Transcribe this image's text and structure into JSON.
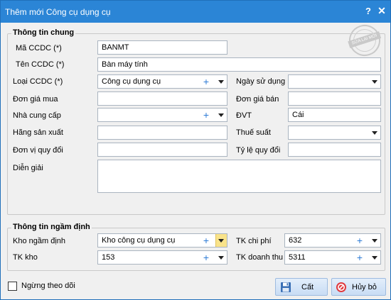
{
  "window": {
    "title": "Thêm mới Công cụ dụng cụ",
    "help": "?",
    "close": "✕"
  },
  "general": {
    "title": "Thông tin chung",
    "code_label": "Mã CCDC (*)",
    "code_value": "BANMT",
    "name_label": "Tên CCDC (*)",
    "name_value": "Bàn máy tính",
    "type_label": "Loại CCDC (*)",
    "type_value": "Công cụ dụng cụ",
    "use_date_label": "Ngày sử dụng",
    "use_date_value": "",
    "buy_price_label": "Đơn giá mua",
    "buy_price_value": "",
    "sell_price_label": "Đơn giá bán",
    "sell_price_value": "",
    "supplier_label": "Nhà cung cấp",
    "supplier_value": "",
    "unit_label": "ĐVT",
    "unit_value": "Cái",
    "manufacturer_label": "Hãng sản xuất",
    "manufacturer_value": "",
    "tax_label": "Thuế suất",
    "tax_value": "",
    "conv_unit_label": "Đơn vị quy đổi",
    "conv_unit_value": "",
    "conv_rate_label": "Tỷ lệ quy đổi",
    "conv_rate_value": "",
    "desc_label": "Diễn giải",
    "desc_value": ""
  },
  "defaults": {
    "title": "Thông tin ngầm định",
    "warehouse_label": "Kho ngầm định",
    "warehouse_value": "Kho công cụ dụng cụ",
    "expense_label": "TK chi phí",
    "expense_value": "632",
    "stock_label": "TK kho",
    "stock_value": "153",
    "revenue_label": "TK doanh thu",
    "revenue_value": "5311"
  },
  "footer": {
    "stop_tracking_label": "Ngừng theo dõi",
    "stop_tracking_checked": false,
    "save_label": "Cất",
    "cancel_label": "Hủy bỏ"
  },
  "watermark": {
    "text": "Sửa lại mới"
  },
  "icons": {
    "add": "plus-icon",
    "dropdown": "chevron-down-icon",
    "save": "floppy-disk-icon",
    "cancel": "cancel-icon"
  },
  "colors": {
    "titlebar": "#2b85d6",
    "accent": "#2e7cd6",
    "highlight": "#f9e38a"
  }
}
